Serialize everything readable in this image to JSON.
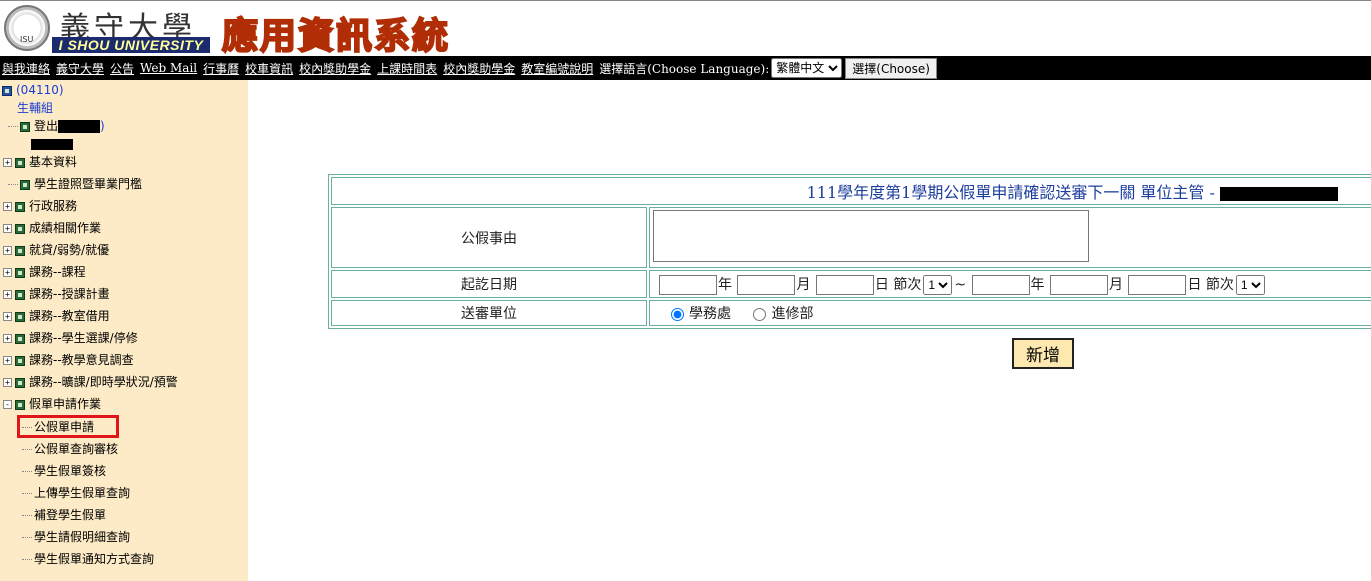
{
  "header": {
    "logo_cn": "義守大學",
    "logo_en": "I SHOU UNIVERSITY",
    "logo_seal_text": "ISU",
    "system_title": "應用資訊系統"
  },
  "topnav": {
    "links": [
      "與我連絡",
      "義守大學",
      "公告",
      "Web Mail",
      "行事曆",
      "校車資訊",
      "校內獎助學金",
      "上課時間表",
      "校內獎助學金",
      "教室編號說明"
    ],
    "lang_label": "選擇語言(Choose Language):",
    "lang_selected": "繁體中文",
    "choose_label": "選擇(Choose)"
  },
  "sidebar": {
    "root_code": "(04110)",
    "unit": "生輔組",
    "logout": "登出",
    "logout_tail": ")",
    "menu": [
      {
        "label": "基本資料",
        "expander": "+"
      },
      {
        "label": "學生證照暨畢業門檻",
        "expander": ""
      },
      {
        "label": "行政服務",
        "expander": "+"
      },
      {
        "label": "成績相關作業",
        "expander": "+"
      },
      {
        "label": "就貸/弱勢/就優",
        "expander": "+"
      },
      {
        "label": "課務--課程",
        "expander": "+"
      },
      {
        "label": "課務--授課計畫",
        "expander": "+"
      },
      {
        "label": "課務--教室借用",
        "expander": "+"
      },
      {
        "label": "課務--學生選課/停修",
        "expander": "+"
      },
      {
        "label": "課務--教學意見調查",
        "expander": "+"
      },
      {
        "label": "課務--曠課/即時學狀況/預警",
        "expander": "+"
      },
      {
        "label": "假單申請作業",
        "expander": "-"
      }
    ],
    "sub_items": [
      "公假單申請",
      "公假單查詢審核",
      "學生假單簽核",
      "上傳學生假單查詢",
      "補登學生假單",
      "學生請假明細查詢",
      "學生假單通知方式查詢"
    ]
  },
  "form": {
    "title": "111學年度第1學期公假單申請確認送審下一關 單位主管 -",
    "reason_label": "公假事由",
    "date_label": "起訖日期",
    "year_unit": "年",
    "month_unit": "月",
    "day_unit": "日",
    "period_label": "節次",
    "period_value": "1",
    "tilde": "~",
    "dept_label": "送審單位",
    "option_1": "學務處",
    "option_2": "進修部",
    "add_button": "新增"
  }
}
